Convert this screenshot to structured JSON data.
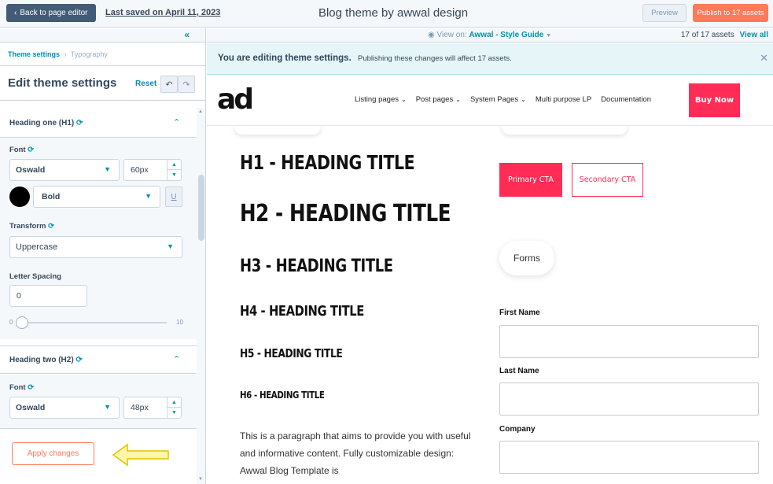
{
  "topbar": {
    "back_label": "Back to page editor",
    "saved_label": "Last saved on April 11, 2023",
    "title": "Blog theme by awwal design",
    "preview_label": "Preview",
    "publish_label": "Publish to 17 assets"
  },
  "sidebar": {
    "breadcrumb_link": "Theme settings",
    "breadcrumb_current": "Typography",
    "title": "Edit theme settings",
    "reset_label": "Reset",
    "heading_one": {
      "label": "Heading one (H1)",
      "font_label": "Font",
      "font_family": "Oswald",
      "font_size": "60px",
      "weight": "Bold",
      "underline": "U",
      "transform_label": "Transform",
      "transform_value": "Uppercase",
      "letter_spacing_label": "Letter Spacing",
      "letter_spacing_value": "0",
      "slider_min": "0",
      "slider_max": "10",
      "slider_value": 0,
      "color": "#000000"
    },
    "heading_two": {
      "label": "Heading two (H2)",
      "font_label": "Font",
      "font_family": "Oswald",
      "font_size": "48px"
    },
    "apply_label": "Apply changes"
  },
  "viewbar": {
    "view_on_prefix": "View on:",
    "view_on_value": "Awwal - Style Guide",
    "assets_count": "17 of 17 assets",
    "view_all": "View all"
  },
  "notice": {
    "strong": "You are editing theme settings.",
    "message": "Publishing these changes will affect 17 assets."
  },
  "site": {
    "logo": "ad",
    "nav": [
      {
        "label": "Listing pages",
        "dropdown": true
      },
      {
        "label": "Post pages",
        "dropdown": true
      },
      {
        "label": "System Pages",
        "dropdown": true
      },
      {
        "label": "Multi purpose LP",
        "dropdown": false
      },
      {
        "label": "Documentation",
        "dropdown": false
      }
    ],
    "buy_now": "Buy Now"
  },
  "preview": {
    "h1": "H1 - HEADING TITLE",
    "h2": "H2 - HEADING TITLE",
    "h3": "H3 - HEADING TITLE",
    "h4": "H4 - HEADING TITLE",
    "h5": "H5 - HEADING TITLE",
    "h6": "H6 - HEADING TITLE",
    "paragraph": "This is a paragraph that aims to provide you with useful and informative content. Fully customizable design: Awwal Blog Template is",
    "primary_cta": "Primary CTA",
    "secondary_cta": "Secondary CTA",
    "forms": "Forms",
    "fields": [
      "First Name",
      "Last Name",
      "Company"
    ]
  },
  "colors": {
    "accent": "#0091ae",
    "publish": "#ff7a59",
    "brand_pink": "#ff2d55",
    "nav_dark": "#425b76"
  }
}
